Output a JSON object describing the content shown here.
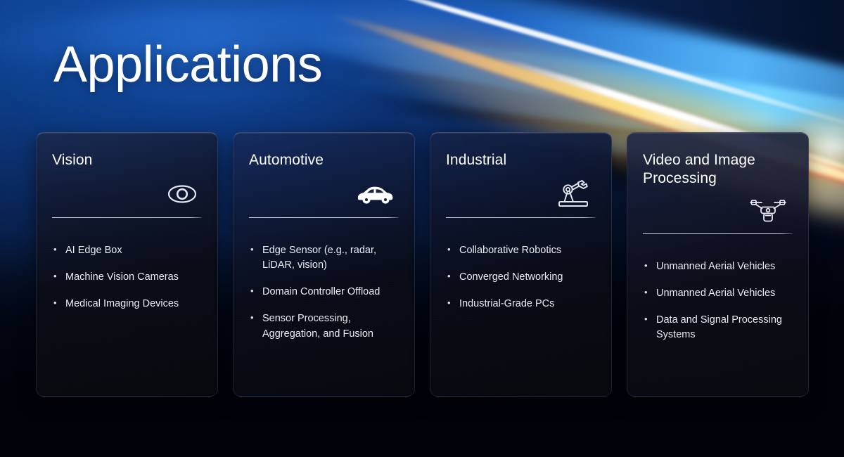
{
  "slide": {
    "title": "Applications",
    "accent_blue": "#0d3b84",
    "accent_streak": "#ffd24a",
    "card_bg": "#10141f",
    "text_color": "#e8ecf3"
  },
  "cards": [
    {
      "title": "Vision",
      "icon": "eye-icon",
      "bullets": [
        "AI Edge Box",
        "Machine Vision Cameras",
        "Medical Imaging Devices"
      ]
    },
    {
      "title": "Automotive",
      "icon": "car-icon",
      "bullets": [
        "Edge Sensor (e.g., radar, LiDAR, vision)",
        "Domain Controller Offload",
        "Sensor Processing, Aggregation, and Fusion"
      ]
    },
    {
      "title": "Industrial",
      "icon": "robot-arm-icon",
      "bullets": [
        "Collaborative Robotics",
        "Converged Networking",
        "Industrial-Grade PCs"
      ]
    },
    {
      "title": "Video and Image Processing",
      "icon": "drone-icon",
      "bullets": [
        "Unmanned Aerial Vehicles",
        "Unmanned Aerial Vehicles",
        "Data and Signal Processing Systems"
      ]
    }
  ]
}
